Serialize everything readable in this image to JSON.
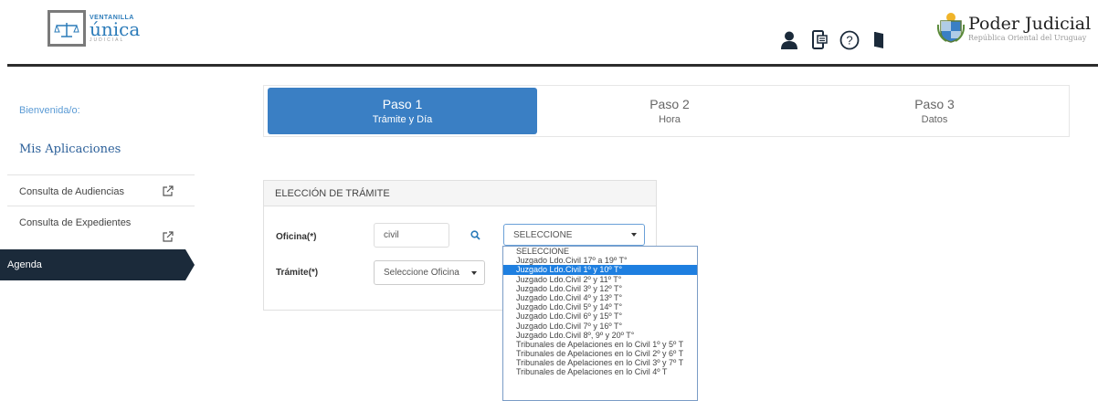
{
  "header": {
    "logo_top": "VENTANILLA",
    "logo_main": "única",
    "logo_sub": "JUDICIAL",
    "org_title": "Poder Judicial",
    "org_subtitle": "República Oriental del Uruguay",
    "icons": [
      "user-icon",
      "mobile-icon",
      "help-icon",
      "door-exit-icon"
    ]
  },
  "sidebar": {
    "welcome": "Bienvenida/o:",
    "apps_title": "Mis Aplicaciones",
    "items": [
      {
        "label": "Consulta de Audiencias"
      },
      {
        "label": "Consulta de Expedientes"
      },
      {
        "label": "Agenda"
      }
    ]
  },
  "steps": [
    {
      "name": "Paso 1",
      "sub": "Trámite y Día",
      "active": true
    },
    {
      "name": "Paso 2",
      "sub": "Hora",
      "active": false
    },
    {
      "name": "Paso 3",
      "sub": "Datos",
      "active": false
    }
  ],
  "form": {
    "title": "ELECCIÓN DE TRÁMITE",
    "oficina_label": "Oficina(*)",
    "oficina_value": "civil",
    "oficina_select": "SELECCIONE",
    "tramite_label": "Trámite(*)",
    "tramite_select": "Seleccione Oficina"
  },
  "dropdown": {
    "options": [
      "SELECCIONE",
      "Juzgado Ldo.Civil 17º a 19º T°",
      "Juzgado Ldo.Civil 1º y 10º T°",
      "Juzgado Ldo.Civil 2º y 11º T°",
      "Juzgado Ldo.Civil 3º y 12º T°",
      "Juzgado Ldo.Civil 4º y 13º T°",
      "Juzgado Ldo.Civil 5º y 14º T°",
      "Juzgado Ldo.Civil 6º y 15º T°",
      "Juzgado Ldo.Civil 7º y 16º T°",
      "Juzgado Ldo.Civil 8º, 9º y 20º T°",
      "Tribunales de Apelaciones en lo Civil 1º y 5º T",
      "Tribunales de Apelaciones en lo Civil 2º y 6º T",
      "Tribunales de Apelaciones en lo Civil 3º y 7º T",
      "Tribunales de Apelaciones en lo Civil 4º T"
    ],
    "highlighted_index": 2
  },
  "colors": {
    "accent": "#3a7fc4",
    "sidebar_active": "#1b2a3a",
    "highlight": "#1e7fe0"
  }
}
